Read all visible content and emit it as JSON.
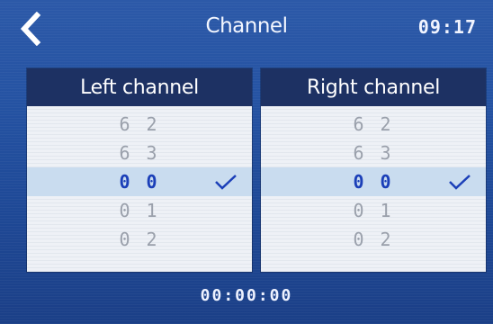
{
  "header": {
    "title": "Channel",
    "clock": "09:17",
    "back_icon": "chevron-left-icon"
  },
  "left_panel": {
    "title": "Left channel",
    "items": [
      {
        "label": "6 2",
        "selected": false
      },
      {
        "label": "6 3",
        "selected": false
      },
      {
        "label": "0 0",
        "selected": true
      },
      {
        "label": "0 1",
        "selected": false
      },
      {
        "label": "0 2",
        "selected": false
      }
    ]
  },
  "right_panel": {
    "title": "Right channel",
    "items": [
      {
        "label": "6 2",
        "selected": false
      },
      {
        "label": "6 3",
        "selected": false
      },
      {
        "label": "0 0",
        "selected": true
      },
      {
        "label": "0 1",
        "selected": false
      },
      {
        "label": "0 2",
        "selected": false
      }
    ]
  },
  "footer": {
    "timer": "00:00:00"
  },
  "colors": {
    "background": "#2553a3",
    "panel_header": "#1d3163",
    "list_background": "#eef1f6",
    "selected_row": "#c9dcef",
    "selected_text": "#1b3fb8",
    "unselected_text": "#9aa0ab",
    "check_icon": "#1b3fb8"
  }
}
